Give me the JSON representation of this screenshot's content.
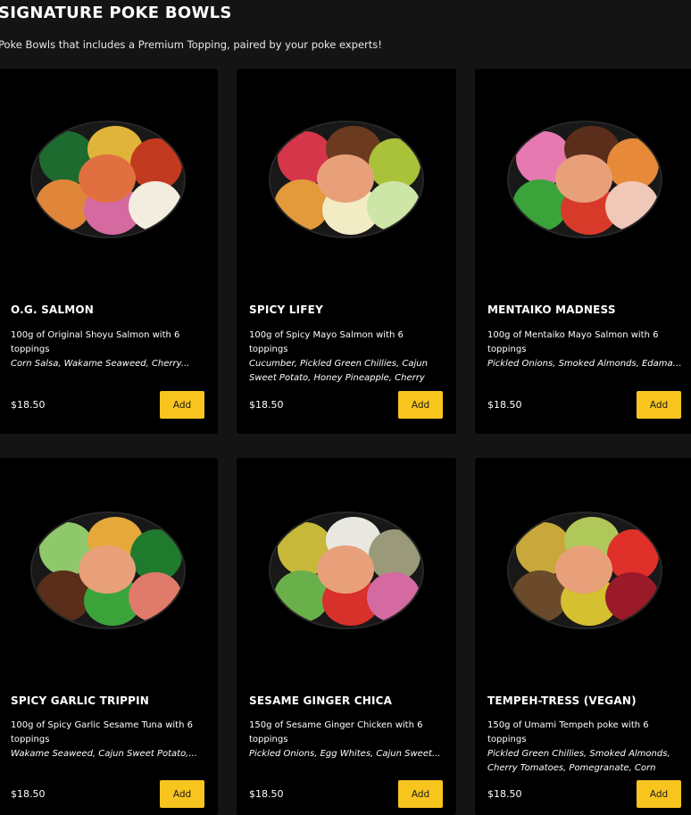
{
  "header": {
    "title": "SIGNATURE POKE BOWLS",
    "subtitle": "Poke Bowls that includes a Premium Topping, paired by your poke experts!"
  },
  "products": [
    {
      "name": "O.G. SALMON",
      "description": "100g of Original Shoyu Salmon with 6 toppings",
      "toppings": "Corn Salsa, Wakame Seaweed, Cherry...",
      "price": "$18.50",
      "add_label": "Add",
      "bowl_colors": [
        "#1d6b2e",
        "#e0b43a",
        "#c23a1f",
        "#e0863a",
        "#d46aa0",
        "#f3ede0"
      ]
    },
    {
      "name": "SPICY LIFEY",
      "description": "100g of Spicy Mayo Salmon with 6 toppings",
      "toppings": "Cucumber, Pickled Green Chillies, Cajun Sweet Potato, Honey Pineapple, Cherry Tomatoes,...",
      "price": "$18.50",
      "add_label": "Add",
      "bowl_colors": [
        "#d6364a",
        "#6b3a1f",
        "#a9c23a",
        "#e39a3a",
        "#f2ecc4",
        "#cde6a8"
      ]
    },
    {
      "name": "MENTAIKO MADNESS",
      "description": "100g of Mentaiko Mayo Salmon with 6 toppings",
      "toppings": "Pickled Onions, Smoked Almonds, Edamame...",
      "price": "$18.50",
      "add_label": "Add",
      "bowl_colors": [
        "#e67ab0",
        "#5a2e1a",
        "#e68a3a",
        "#3aa43a",
        "#d83a2a",
        "#f0c8b8"
      ]
    },
    {
      "name": "SPICY GARLIC TRIPPIN",
      "description": "100g of Spicy Garlic Sesame Tuna with 6 toppings",
      "toppings": "Wakame Seaweed, Cajun Sweet Potato,...",
      "price": "$18.50",
      "add_label": "Add",
      "bowl_colors": [
        "#8fc86a",
        "#e6a83a",
        "#1f7a2e",
        "#5a2e1a",
        "#3aa43a",
        "#e07a6a"
      ]
    },
    {
      "name": "SESAME GINGER CHICA",
      "description": "150g of Sesame Ginger Chicken with 6 toppings",
      "toppings": "Pickled Onions, Egg Whites, Cajun Sweet...",
      "price": "$18.50",
      "add_label": "Add",
      "bowl_colors": [
        "#c8b83a",
        "#e8e8e0",
        "#9a9a7a",
        "#6ab04a",
        "#d8302a",
        "#d46aa0"
      ]
    },
    {
      "name": "TEMPEH-TRESS (VEGAN)",
      "description": "150g of Umami Tempeh poke with 6 toppings",
      "toppings": "Pickled Green Chillies, Smoked Almonds, Cherry Tomatoes, Pomegranate, Corn Salsa,...",
      "price": "$18.50",
      "add_label": "Add",
      "bowl_colors": [
        "#c8a83a",
        "#b0c85a",
        "#e0302a",
        "#6a4a2a",
        "#d4c030",
        "#9a1a2a"
      ]
    }
  ]
}
